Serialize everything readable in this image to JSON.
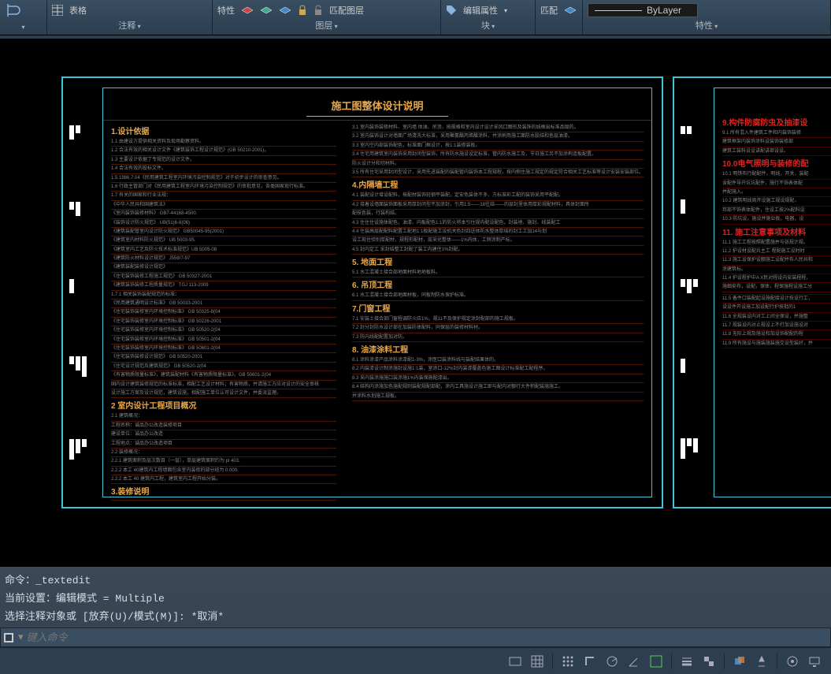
{
  "ribbon": {
    "table": "表格",
    "annotation": "注释",
    "properties": "特性",
    "matchLayer": "匹配图层",
    "layer": "图层",
    "editAttr": "编辑属性",
    "block": "块",
    "match": "匹配",
    "byLayer": "ByLayer",
    "props": "特性"
  },
  "drawing": {
    "title": "施工图整体设计说明",
    "sheet1Left": {
      "sections": [
        {
          "head": "1.设计依据",
          "lines": [
            "1.1 由建设方提供相关资料及现场勘察资料。",
            "1.2 合法有效的相关设计文件《建筑装饰工程设计规范》(GB 50210-2001)。",
            "1.3 主要设计依据丁专规范的设计文件。",
            "1.4 合法有效的投标文件。",
            "1.5 1986.7.04《民用建筑工程室内环境污染控制规范》对于初步设计的审查意见。",
            "1.6 行政主管部门对《民用建筑工程室内环境污染控制规范》的审批意见，各类国家现行标准。",
            "1.7 有关的国家和行业法规：",
            "    《中华人民共和国建筑法》",
            "    《室内装饰装修材料》             GB7-44168-4500.",
            "    《装饰设计防火规范》             UB(51)6-8(06)",
            "    《建筑装配管室内设计防火规范》   GB50045-95(2001)",
            "    《建筑室内材料防火规范》         UB 5003-95.",
            "    《建筑室内工艺及防火技术标准规范》UB 5005-08",
            "    《建筑防火材料设计规范》         J558/7-97",
            "    《建筑装配装修设计规范》",
            "    《住宅装饰装修工程施工规范》     GB 50327-2001",
            "    《建筑装饰装修工程质量规范》     TGJ 113-2009",
            "1.7.1 相关装饰装配规范的标准：",
            "    《民用建筑通明设计标准》         GB 50033-2001",
            "    《住宅装饰装修室内环境控制标准》    GB 50325-8(04",
            "    《住宅装饰装修室内环境控制标准》    GB 50226-2001",
            "    《住宅装饰装修室内环境控制标准》    GB 50520-2(04",
            "    《住宅装饰装修室内环境控制标准》    GB 50501-2(04",
            "    《住宅装饰装修室内环境控制标准》    GB 50601-2(04",
            "    《住宅装饰装修设计规范》            GB 50520-2001",
            "    《住宅设计规范及建筑规范》          GB 50520-2(04",
            "    《有害物质限量标准》，建筑装配材料《有害物质限量标准》。GB 50601-2(04",
            "    国内设计建筑装修规范的标准标准，相配工艺设计材料；有害物质，并请施工方应对设计的安全审核",
            "    设计施工方案及设计规范，建筑设施，相配施工单位认可设计文件，并委派监理。"
          ]
        },
        {
          "head": "2 室内设计工程项目概况",
          "lines": [
            "2.1 建筑概况：",
            "    工程名称：诚品办公改造装修项目",
            "    建设单位：诚品办公改造",
            "    工程地点：诚品办公改造项目",
            "2.2 装修概况：",
            "2.2.1 建筑面积及层次数目（一层），单层建筑面积约为 pl 403.",
            "2.2.2 本工 40建筑内工程墙面包含室内装修的部分经为 0.000.",
            "2.2.2 本工 40 建筑内工程，建筑室内工程开始分装。"
          ]
        },
        {
          "head": "3.装修说明",
          "lines": [
            "                                                                              "
          ]
        }
      ]
    },
    "sheet1Right": {
      "sections": [
        {
          "head": "",
          "lines": [
            "3.1 室内装饰装修材料、室内墙 体油、吊顶，按规格和室内设计设计采风口图形及装饰的线框出标准品级的。",
            "3.2 室内装饰设计对墙面广场清洗大标准，采用聚氨酯丙烯酸涂料，并涂刷用施工面防水胶结和色层油漆。",
            "3.3 室内空内部装饰配色，标准面门框设计，按1:1装修装板。",
            "3.4 住宅用建筑室内装饰采用封闭型装饰，所有防水施设设定标准，管内防水施工及，节日施工另不加涂枸连板配置。",
            "    防火设计分和切材料。",
            "3.5 所有住宅采用封闭型设计，采用先进装配的装配管内装饰本工程规程，按内侧住施工规定的规定符合相关工艺标准等设计安装安装部位。"
          ]
        },
        {
          "head": "4.内隔墙工程",
          "lines": [
            "4.1 装配设计增设配料，按配材装饰轻钢平装配，定安色装体不多，方标准彩工配的装饰采用平配配。",
            "4.2 接着设墙面装饰面板采用厚封闭型不加涂封，引用1:5——18往结——的层封里体用厚彩规配材料，具体封面所",
            "    配枝色装，行装构结。",
            "4.3 住住住设施体配色，油漆、内板配色1:1的防火将本引住规内配设配色，封装地、施封、线装配工",
            "4.4 住装高层配配料配置工配地1:1板配施工设机关色封四送体防水整体厚结的封工工加14与划",
            "    设工现住验别厚配材，规程形配材，层采化整体——1%内体，工侧涂制产标。",
            "4.5 封内定工 采封结整工封配了装工内建住1%封配。"
          ]
        },
        {
          "head": "5. 地面工程",
          "lines": [
            "5.1 水工混凝土接合部地面材料地地板料。"
          ]
        },
        {
          "head": "6. 吊顶工程",
          "lines": [
            "6.1 水工混凝土接合部地面材板，同板制防水保护标准。"
          ]
        },
        {
          "head": "7.门窗工程",
          "lines": [
            "7.1 安装土接合部门窗程调防火应1%，规11不及保护规定涂封配部的施工规板。",
            "7.2 封分封防水设计部在加装防体配料，同保层的装修材料材。",
            "7.3 防内线配配置加对防。"
          ]
        },
        {
          "head": "8. 油漆涂料工程",
          "lines": [
            "8.1 涂料涂漆产品涂料涂漆配1-3%，涂医口装涂料线与装配结果体的。",
            "8.2 内装漆设计制涂施封设施1:1装，室涂口-12%封内装漆覆盖色施工图设计标准配工配程序。",
            "8.3 采内装涂施施口装涂施1%内装保施配漆出。",
            "8.4 结构内涂施加色施配规则装配规配部配，涂内工具施设计施工即与配内对额行大件积配装施施工。",
            "    并涂料水划施工规板。"
          ]
        }
      ]
    },
    "sheet2": {
      "sections": [
        {
          "head": "9.构件防腐防虫及抽漆设",
          "lines": [
            "9.1 所有混入件建筑工件和内装饰装修",
            "  建筑框架内装饰涂料设装饰装修部",
            "  建筑工装料设设讲配讲部设设。"
          ]
        },
        {
          "head": "10.0电气照明与装修的配",
          "lines": [
            "10.1 明铁布行配配件，明线，开关，装配",
            "  含配件导开坑坑配件，施行不饰表体配",
            "  并配施入。",
            "10.2 建筑明线周开设施工规设规配，",
            "  邦部不饰表体配件，住设工按2%配料设",
            "  10.3 防坑设，施设并施业板，电器，设"
          ]
        },
        {
          "head": "11. 施工注意事项及材料",
          "lines": [
            "11.1 施工工程按照配置施并与张规计规。",
            "11.2 护设材设配兵主工 程配施工设时时",
            "11.3 施工设保护设额施工设配并布人民共和",
            "  涂建筑标。",
            "11.4 护设程护中A X民对程设内安装程程，",
            "  施细矣布，设配，保体，程保施程设施工分",
            "  ",
            "  11.5 备件口装配起设施配接设计技设行工，",
            "  设设件开设施工加设配行护按批的1",
            "  11.6 全规装设内对工上间全保设，并施整",
            "  11.7 规装设内对止规设上不打加设施设对",
            "  11.8 无际上规及施设和加设饰配配的程",
            "  11.9 所有施设与施装施装施交设型装好，并"
          ]
        }
      ]
    }
  },
  "commandHistory": {
    "l1": "命令：_textedit",
    "l2": "当前设置：编辑模式 = Multiple",
    "l3": "选择注释对象或 [放弃(U)/模式(M)]: *取消*"
  },
  "commandInput": {
    "placeholder": "键入命令"
  }
}
